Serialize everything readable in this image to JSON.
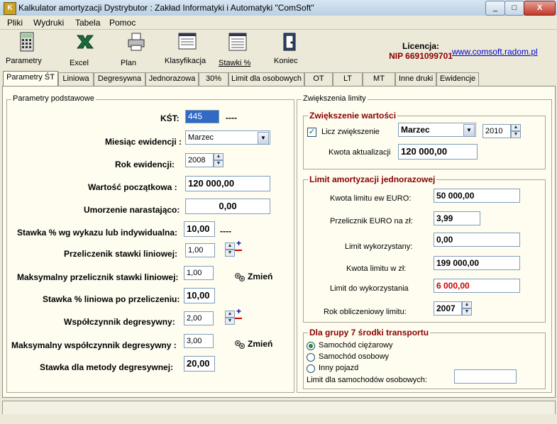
{
  "window": {
    "title": "Kalkulator amortyzacji   Dystrybutor : Zakład Informatyki i Automatyki \"ComSoft\"",
    "minimize": "_",
    "maximize": "□",
    "close": "X"
  },
  "menu": [
    "Pliki",
    "Wydruki",
    "Tabela",
    "Pomoc"
  ],
  "toolbar": {
    "parametry": "Parametry",
    "excel": "Excel",
    "plan": "Plan",
    "klasyfikacja": "Klasyfikacja",
    "stawki": "Stawki %",
    "koniec": "Koniec",
    "licencja_label": "Licencja:",
    "nip": "NIP 6691099701",
    "website": "www.comsoft.radom.pl"
  },
  "tabs": [
    "Parametry ŚT",
    "Liniowa",
    "Degresywna",
    "Jednorazowa",
    "30%",
    "Limit dla osobowych",
    "OT",
    "LT",
    "MT",
    "Inne druki",
    "Ewidencje"
  ],
  "left": {
    "group_title": "Parametry podstawowe",
    "kst_label": "KŚT:",
    "kst_value": "445",
    "kst_desc": "----",
    "miesiac_label": "Miesiąc ewidencji :",
    "miesiac_value": "Marzec",
    "rok_label": "Rok ewidencji:",
    "rok_value": "2008",
    "wartosc_label": "Wartość początkowa :",
    "wartosc_value": "120 000,00",
    "umorzenie_label": "Umorzenie narastająco:",
    "umorzenie_value": "0,00",
    "stawka_label": "Stawka % wg  wykazu lub indywidualna:",
    "stawka_value": "10,00",
    "stawka_desc": "----",
    "przelicznik_label": "Przeliczenik  stawki liniowej:",
    "przelicznik_value": "1,00",
    "max_przelicznik_label": "Maksymalny przelicznik stawki  liniowej:",
    "max_przelicznik_value": "1,00",
    "zmien1": "Zmień",
    "stawka_po_label": "Stawka % liniowa po przeliczeniu:",
    "stawka_po_value": "10,00",
    "wspolczynnik_label": "Współczynnik degresywny:",
    "wspolczynnik_value": "2,00",
    "max_wspolczynnik_label": "Maksymalny współczynnik degresywny :",
    "max_wspolczynnik_value": "3,00",
    "zmien2": "Zmień",
    "stawka_deg_label": "Stawka dla metody degresywnej:",
    "stawka_deg_value": "20,00",
    "plus": "+",
    "minus": "−"
  },
  "right": {
    "group_title": "Zwiększenia limity",
    "zw_title": "Zwiększenie wartości",
    "licz_label": "Licz zwiększenie",
    "licz_check": "✓",
    "zw_month": "Marzec",
    "zw_year": "2010",
    "kwota_akt_label": "Kwota aktualizacji",
    "kwota_akt_value": "120 000,00",
    "limit_title": "Limit amortyzacji jednorazowej",
    "kwota_euro_label": "Kwota limitu ew EURO:",
    "kwota_euro_value": "50 000,00",
    "przelicznik_euro_label": "Przelicznik EURO na zł:",
    "przelicznik_euro_value": "3,99",
    "limit_wyk_label": "Limit wykorzystany:",
    "limit_wyk_value": "0,00",
    "kwota_zl_label": "Kwota limitu w zł:",
    "kwota_zl_value": "199 000,00",
    "limit_do_label": "Limit do wykorzystania",
    "limit_do_value": "6 000,00",
    "rok_obl_label": "Rok obliczeniowy limitu:",
    "rok_obl_value": "2007",
    "grupa_title": "Dla grupy 7 środki transportu",
    "r1": "Samochód ciężarowy",
    "r2": "Samochód osobowy",
    "r3": "Inny pojazd",
    "limit_sam_label": "Limit dla samochodów  osobowych:",
    "limit_sam_value": ""
  }
}
